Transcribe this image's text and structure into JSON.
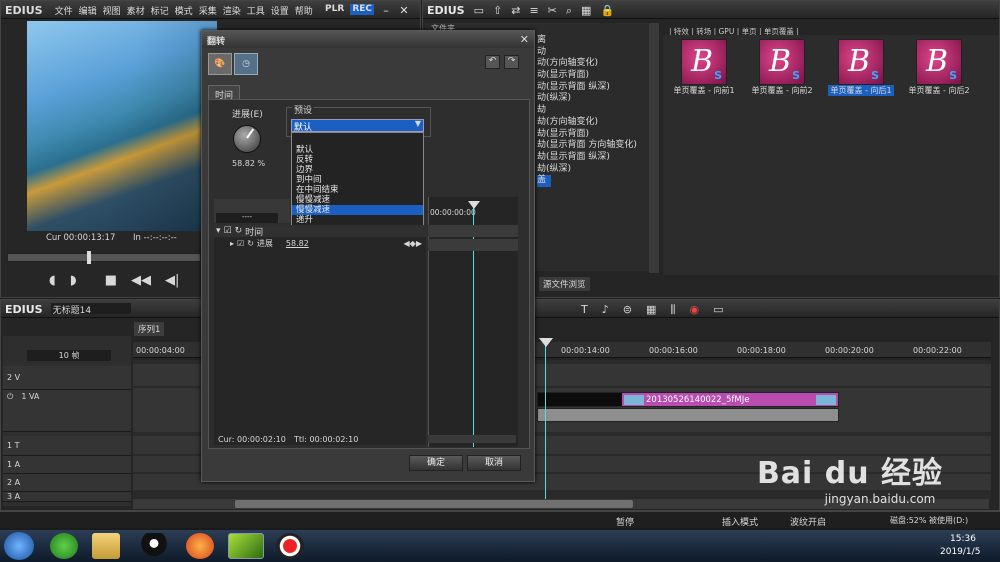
{
  "player": {
    "logo": "EDIUS",
    "menu": [
      "文件",
      "编辑",
      "视图",
      "素材",
      "标记",
      "模式",
      "采集",
      "渲染",
      "工具",
      "设置",
      "帮助"
    ],
    "plr": "PLR",
    "rec": "REC",
    "cur": "Cur 00:00:13:17",
    "in": "In --:--:--:--"
  },
  "bin": {
    "logo": "EDIUS",
    "path": "| 特效 | 转场 | GPU | 单页 | 单页覆盖 |",
    "tree_header": "文件夹",
    "tree": [
      "离",
      "动",
      "动(方向轴变化)",
      "动(显示背面)",
      "动(显示背面 纵深)",
      "动(纵深)",
      "劫",
      "劫(方向轴变化)",
      "劫(显示背面)",
      "劫(显示背面 方向轴变化)",
      "劫(显示背面 纵深)",
      "劫(纵深)",
      "盖"
    ],
    "source_tab": "源文件浏览",
    "thumbs": [
      {
        "label": "单页覆盖 - 向前1"
      },
      {
        "label": "单页覆盖 - 向前2"
      },
      {
        "label": "单页覆盖 - 向后1"
      },
      {
        "label": "单页覆盖 - 向后2"
      }
    ]
  },
  "timeline": {
    "logo": "EDIUS",
    "project": "无标题14",
    "sequence_tab": "序列1",
    "frames": "10 帧",
    "ruler": [
      "00:00:04:00",
      "00:00:14:00",
      "00:00:16:00",
      "00:00:18:00",
      "00:00:20:00",
      "00:00:22:00"
    ],
    "tracks": [
      "2 V",
      "1 VA",
      "1 T",
      "1 A",
      "2 A",
      "3 A"
    ],
    "clip": "20130526140022_5fMJe"
  },
  "dialog": {
    "title": "翻转",
    "tab": "时间",
    "progress_label": "进展(E)",
    "progress_value": "58.82 %",
    "preset_label": "预设",
    "preset_selected": "默认",
    "options": [
      "默认",
      "反转",
      "边界",
      "到中间",
      "在中间结束",
      "慢慢减速",
      "慢慢减速",
      "递升"
    ],
    "highlight_index": 6,
    "tree_time": "时间",
    "tree_progress": "进展",
    "tree_progress_value": "58.82",
    "timecode": "00:00:00:00",
    "cur": "Cur: 00:00:02:10",
    "ttl": "Ttl: 00:00:02:10",
    "ok": "确定",
    "cancel": "取消",
    "combo": "----"
  },
  "status": {
    "pause": "暂停",
    "insert": "插入模式",
    "ripple": "波纹开启",
    "disk": "磁盘:52% 被使用(D:)"
  },
  "taskbar": {
    "time": "15:36",
    "date": "2019/1/5"
  },
  "watermark": {
    "brand": "Bai du 经验",
    "url": "jingyan.baidu.com"
  }
}
